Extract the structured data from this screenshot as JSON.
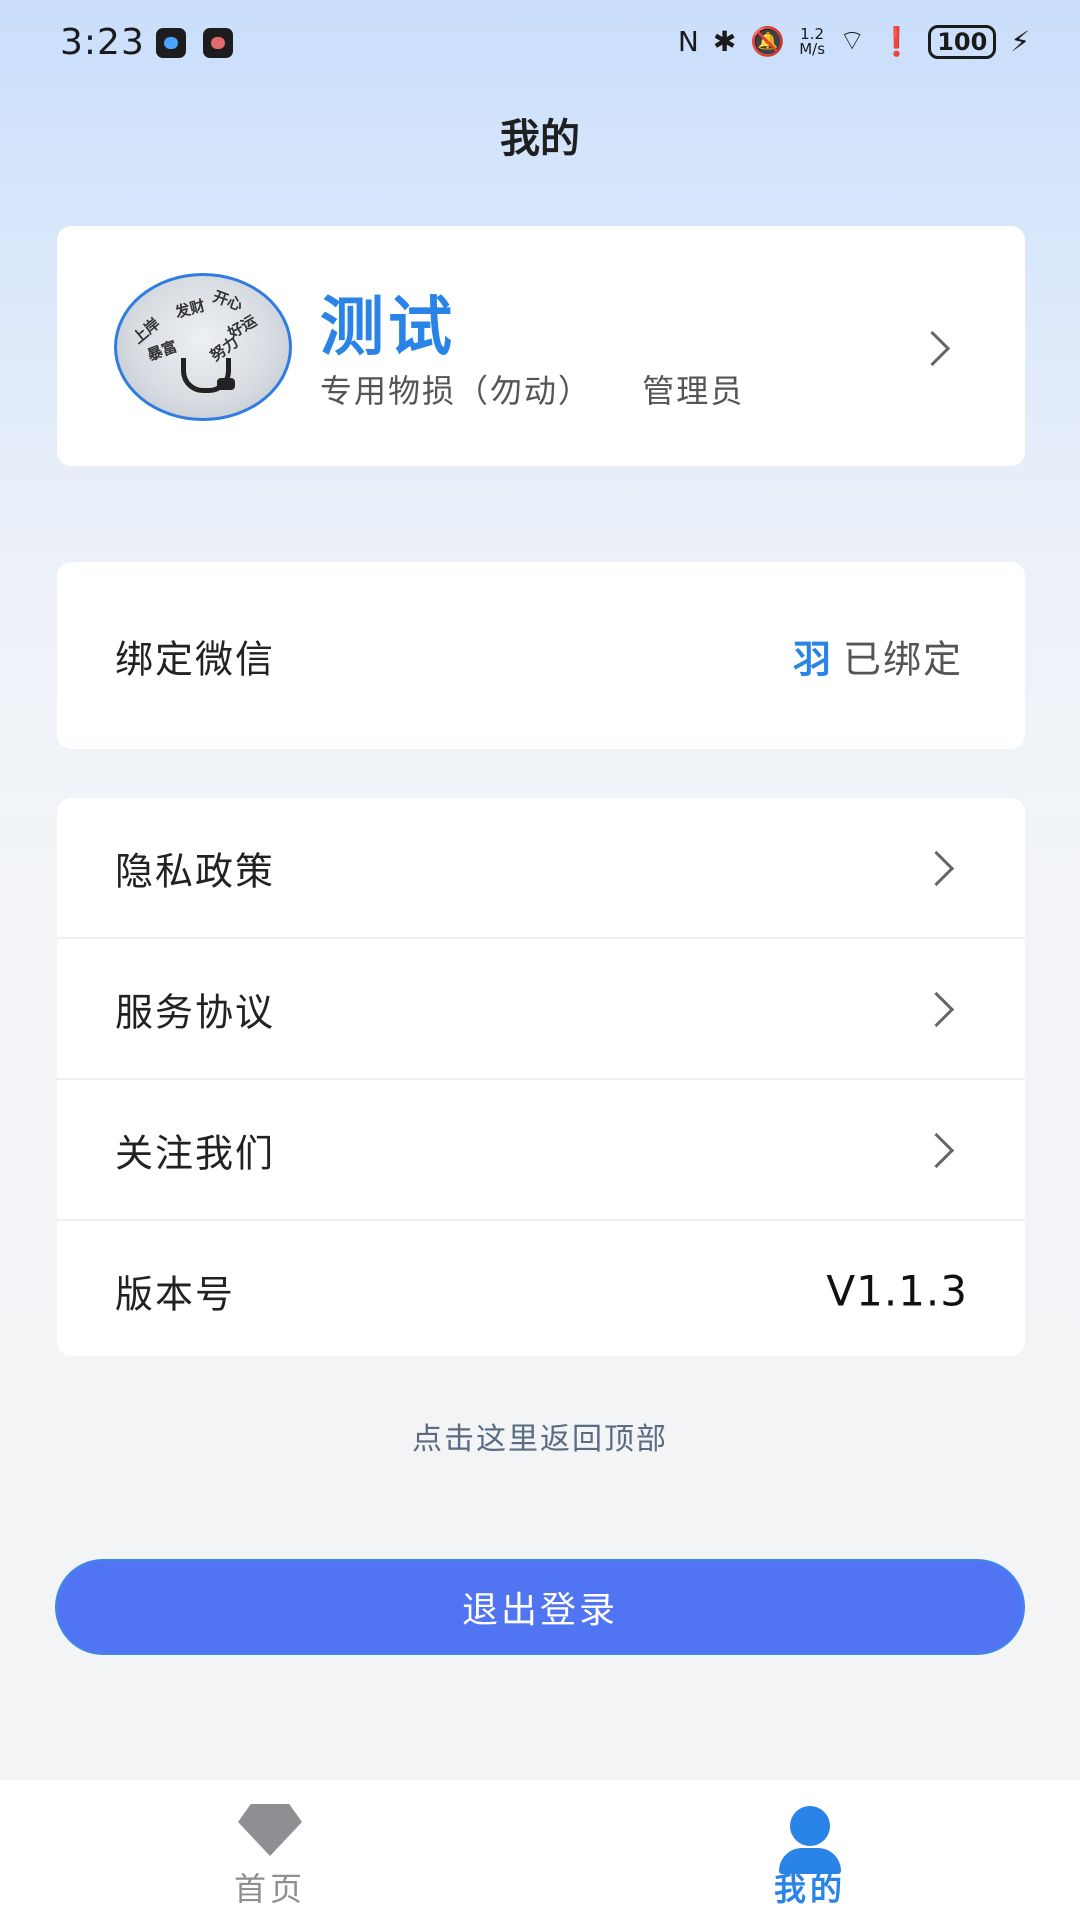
{
  "status_bar": {
    "time": "3:23",
    "net_speed_top": "1.2",
    "net_speed_bottom": "M/s",
    "battery": "100"
  },
  "header": {
    "title": "我的"
  },
  "profile": {
    "name": "测试",
    "department": "专用物损（勿动）",
    "role": "管理员",
    "avatar_scribbles": [
      "发财",
      "开心",
      "好运",
      "上岸",
      "暴富",
      "努力"
    ]
  },
  "wechat": {
    "label": "绑定微信",
    "icon": "羽",
    "status": "已绑定"
  },
  "menu": {
    "privacy": "隐私政策",
    "agreement": "服务协议",
    "follow": "关注我们",
    "version_label": "版本号",
    "version_value": "V1.1.3"
  },
  "back_to_top": "点击这里返回顶部",
  "logout_label": "退出登录",
  "tab_bar": {
    "home": "首页",
    "mine": "我的",
    "active_color": "#2a83e6",
    "inactive_color": "#8d8f93"
  }
}
